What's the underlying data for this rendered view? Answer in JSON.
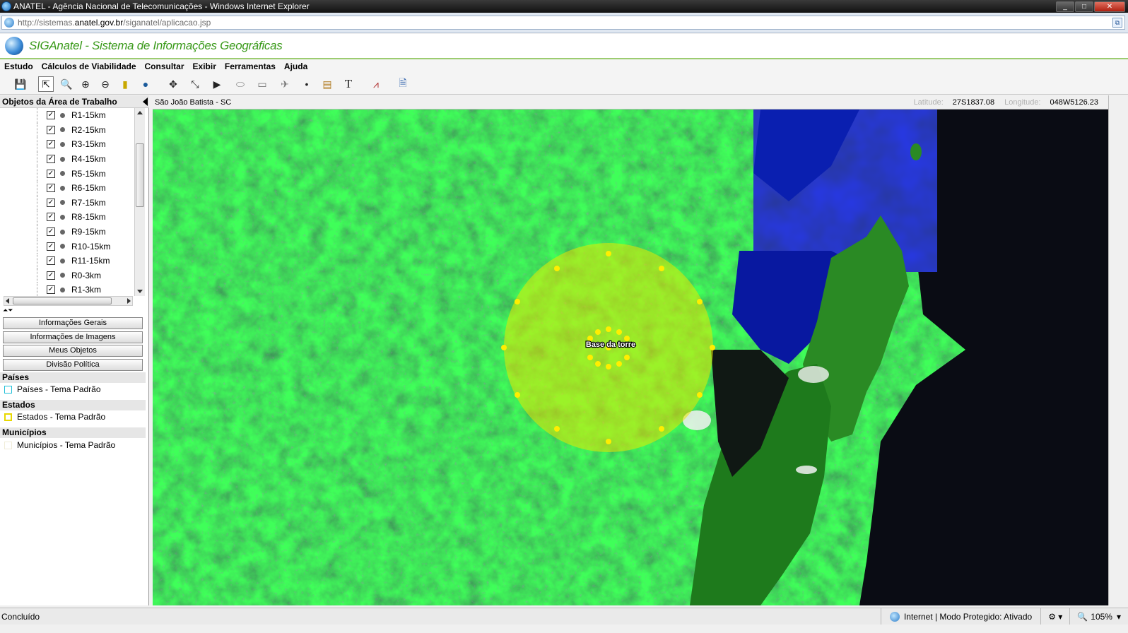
{
  "window": {
    "title": "ANATEL - Agência Nacional de Telecomunicações - Windows Internet Explorer",
    "controls": [
      "_",
      "□",
      "✕"
    ]
  },
  "address": {
    "url_prefix": "http://sistemas.",
    "url_domain": "anatel.gov.br",
    "url_path": "/siganatel/aplicacao.jsp"
  },
  "app": {
    "title": "SIGAnatel - Sistema de Informações Geográficas"
  },
  "menu": [
    "Estudo",
    "Cálculos de Viabilidade",
    "Consultar",
    "Exibir",
    "Ferramentas",
    "Ajuda"
  ],
  "toolbar": {
    "icons": [
      "save-icon",
      "select-arrow-icon",
      "zoom-icon",
      "zoom-in-icon",
      "zoom-out-icon",
      "ruler-icon",
      "globe-icon",
      "pan-icon",
      "line-icon",
      "pointer-icon",
      "ellipse-icon",
      "rectangle-icon",
      "polygon-icon",
      "point-icon",
      "folder-icon",
      "text-icon",
      "chart-icon",
      "report-icon"
    ],
    "glyphs": [
      "💾",
      "⇱",
      "🔍",
      "⊕",
      "⊖",
      "▮",
      "●",
      "✥",
      "⤡",
      "▶",
      "⬭",
      "▭",
      "✈",
      "•",
      "▤",
      "T",
      "⩘",
      "🗎"
    ]
  },
  "left_panel": {
    "header": "Objetos da Área de Trabalho",
    "tree_items": [
      "R1-15km",
      "R2-15km",
      "R3-15km",
      "R4-15km",
      "R5-15km",
      "R6-15km",
      "R7-15km",
      "R8-15km",
      "R9-15km",
      "R10-15km",
      "R11-15km",
      "R0-3km",
      "R1-3km"
    ],
    "checkmark": "✓",
    "buttons": [
      "Informações Gerais",
      "Informações de Imagens",
      "Meus Objetos",
      "Divisão Política"
    ],
    "splitter": "⏶⏷",
    "sections": [
      {
        "title": "Países",
        "item": "Países - Tema Padrão",
        "color": "#20c0d8"
      },
      {
        "title": "Estados",
        "item": "Estados - Tema Padrão",
        "color": "#e8d800"
      },
      {
        "title": "Municípios",
        "item": "Municípios - Tema Padrão",
        "color": "#f0ecd8"
      }
    ]
  },
  "map": {
    "place": "São João Batista - SC",
    "latitude_label": "Latitude:",
    "latitude": "27S1837.08",
    "longitude_label": "Longitude:",
    "longitude": "048W5126.23",
    "marker_label": "Base da torre",
    "circle_color": "#e8e800"
  },
  "status": {
    "text": "Concluído",
    "zone": "Internet | Modo Protegido: Ativado",
    "zoom": "105%"
  }
}
